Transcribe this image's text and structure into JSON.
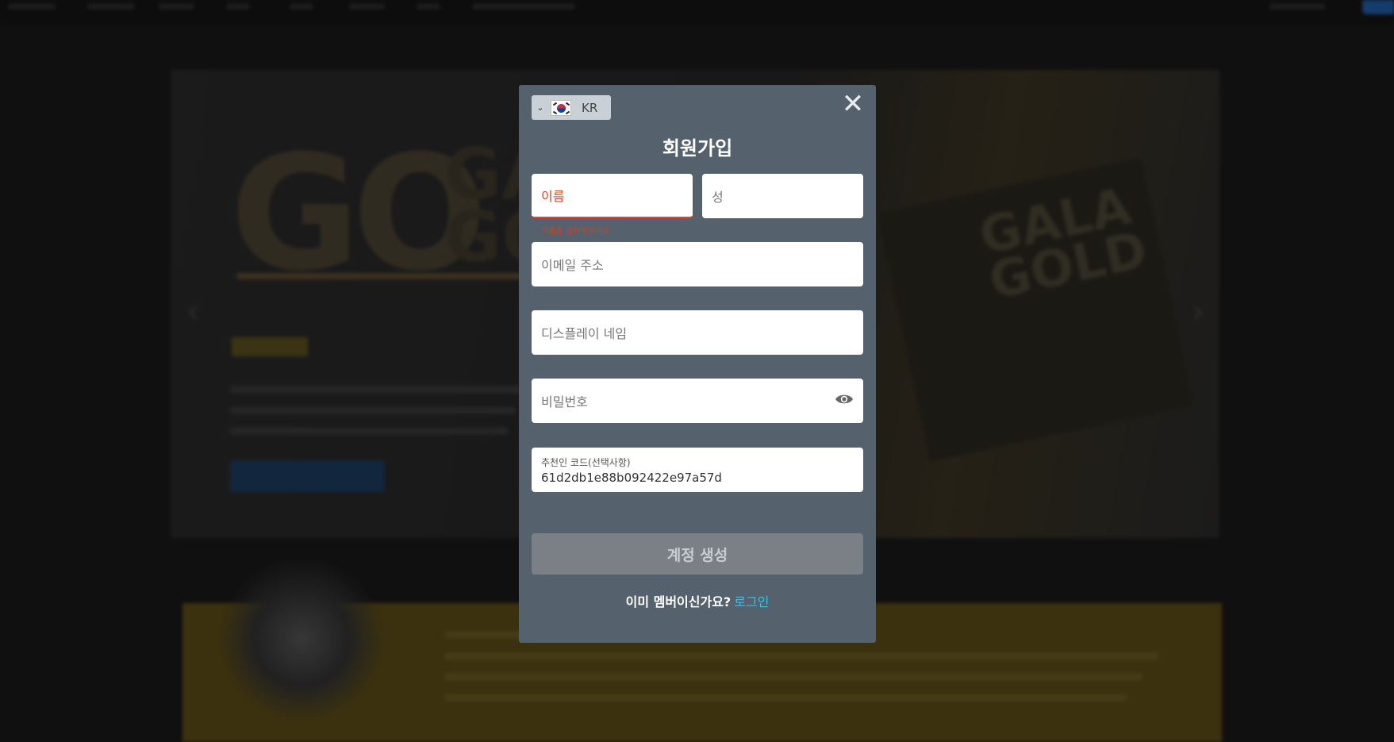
{
  "modal": {
    "country": {
      "code": "KR",
      "flag_icon": "south-korea-flag-icon"
    },
    "close_icon": "close-icon",
    "title": "회원가입",
    "first_name": {
      "placeholder": "이름",
      "error": "이름을 입력해주세요"
    },
    "last_name": {
      "placeholder": "성"
    },
    "email": {
      "placeholder": "이메일 주소"
    },
    "display_name": {
      "placeholder": "디스플레이 네임"
    },
    "password": {
      "placeholder": "비밀번호",
      "toggle_icon": "eye-icon"
    },
    "referral": {
      "label": "추천인 코드(선택사항)",
      "value": "61d2db1e88b092422e97a57d"
    },
    "submit_label": "계정 생성",
    "footer": {
      "prompt": "이미 멤버이신가요?",
      "login_label": "로그인"
    }
  },
  "colors": {
    "modal_bg": "#55616c",
    "error": "#d9482b",
    "link": "#3ac4e6",
    "button_disabled": "#7a8086"
  }
}
